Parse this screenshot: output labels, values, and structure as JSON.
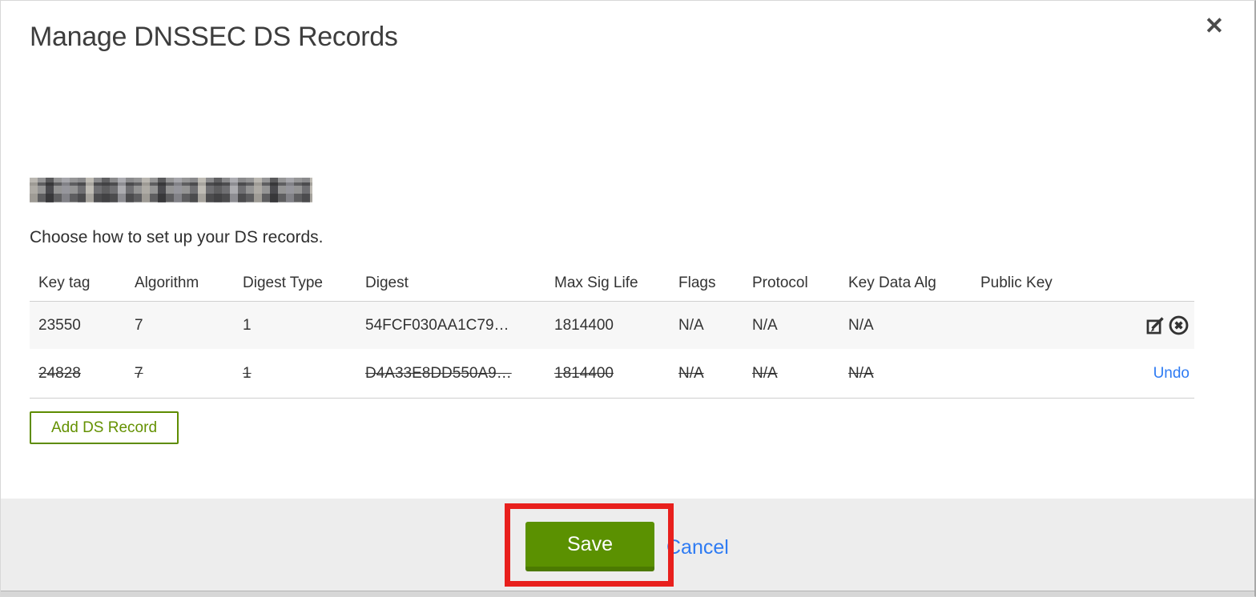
{
  "dialog": {
    "title": "Manage DNSSEC DS Records",
    "close_glyph": "✕",
    "domain_redacted": true,
    "instruction": "Choose how to set up your DS records."
  },
  "table": {
    "headers": {
      "key_tag": "Key tag",
      "algorithm": "Algorithm",
      "digest_type": "Digest Type",
      "digest": "Digest",
      "max_sig_life": "Max Sig Life",
      "flags": "Flags",
      "protocol": "Protocol",
      "key_data_alg": "Key Data Alg",
      "public_key": "Public Key"
    },
    "rows": [
      {
        "key_tag": "23550",
        "algorithm": "7",
        "digest_type": "1",
        "digest": "54FCF030AA1C79…",
        "max_sig_life": "1814400",
        "flags": "N/A",
        "protocol": "N/A",
        "key_data_alg": "N/A",
        "public_key": "",
        "state": "normal",
        "action_icons": [
          "edit-icon",
          "delete-icon"
        ]
      },
      {
        "key_tag": "24828",
        "algorithm": "7",
        "digest_type": "1",
        "digest": "D4A33E8DD550A9…",
        "max_sig_life": "1814400",
        "flags": "N/A",
        "protocol": "N/A",
        "key_data_alg": "N/A",
        "public_key": "",
        "state": "deleted",
        "undo_label": "Undo"
      }
    ]
  },
  "buttons": {
    "add_ds_record": "Add DS Record",
    "save": "Save",
    "cancel": "Cancel"
  },
  "annotation": {
    "type": "highlight-box",
    "target": "save-button",
    "color": "#e8201d"
  },
  "colors": {
    "primary_green": "#5b9101",
    "primary_green_dark": "#4c7a02",
    "outline_green": "#5e8c01",
    "link_blue": "#2e7bf3",
    "row_stripe": "#f7f7f7",
    "footer_gray": "#ededed"
  }
}
